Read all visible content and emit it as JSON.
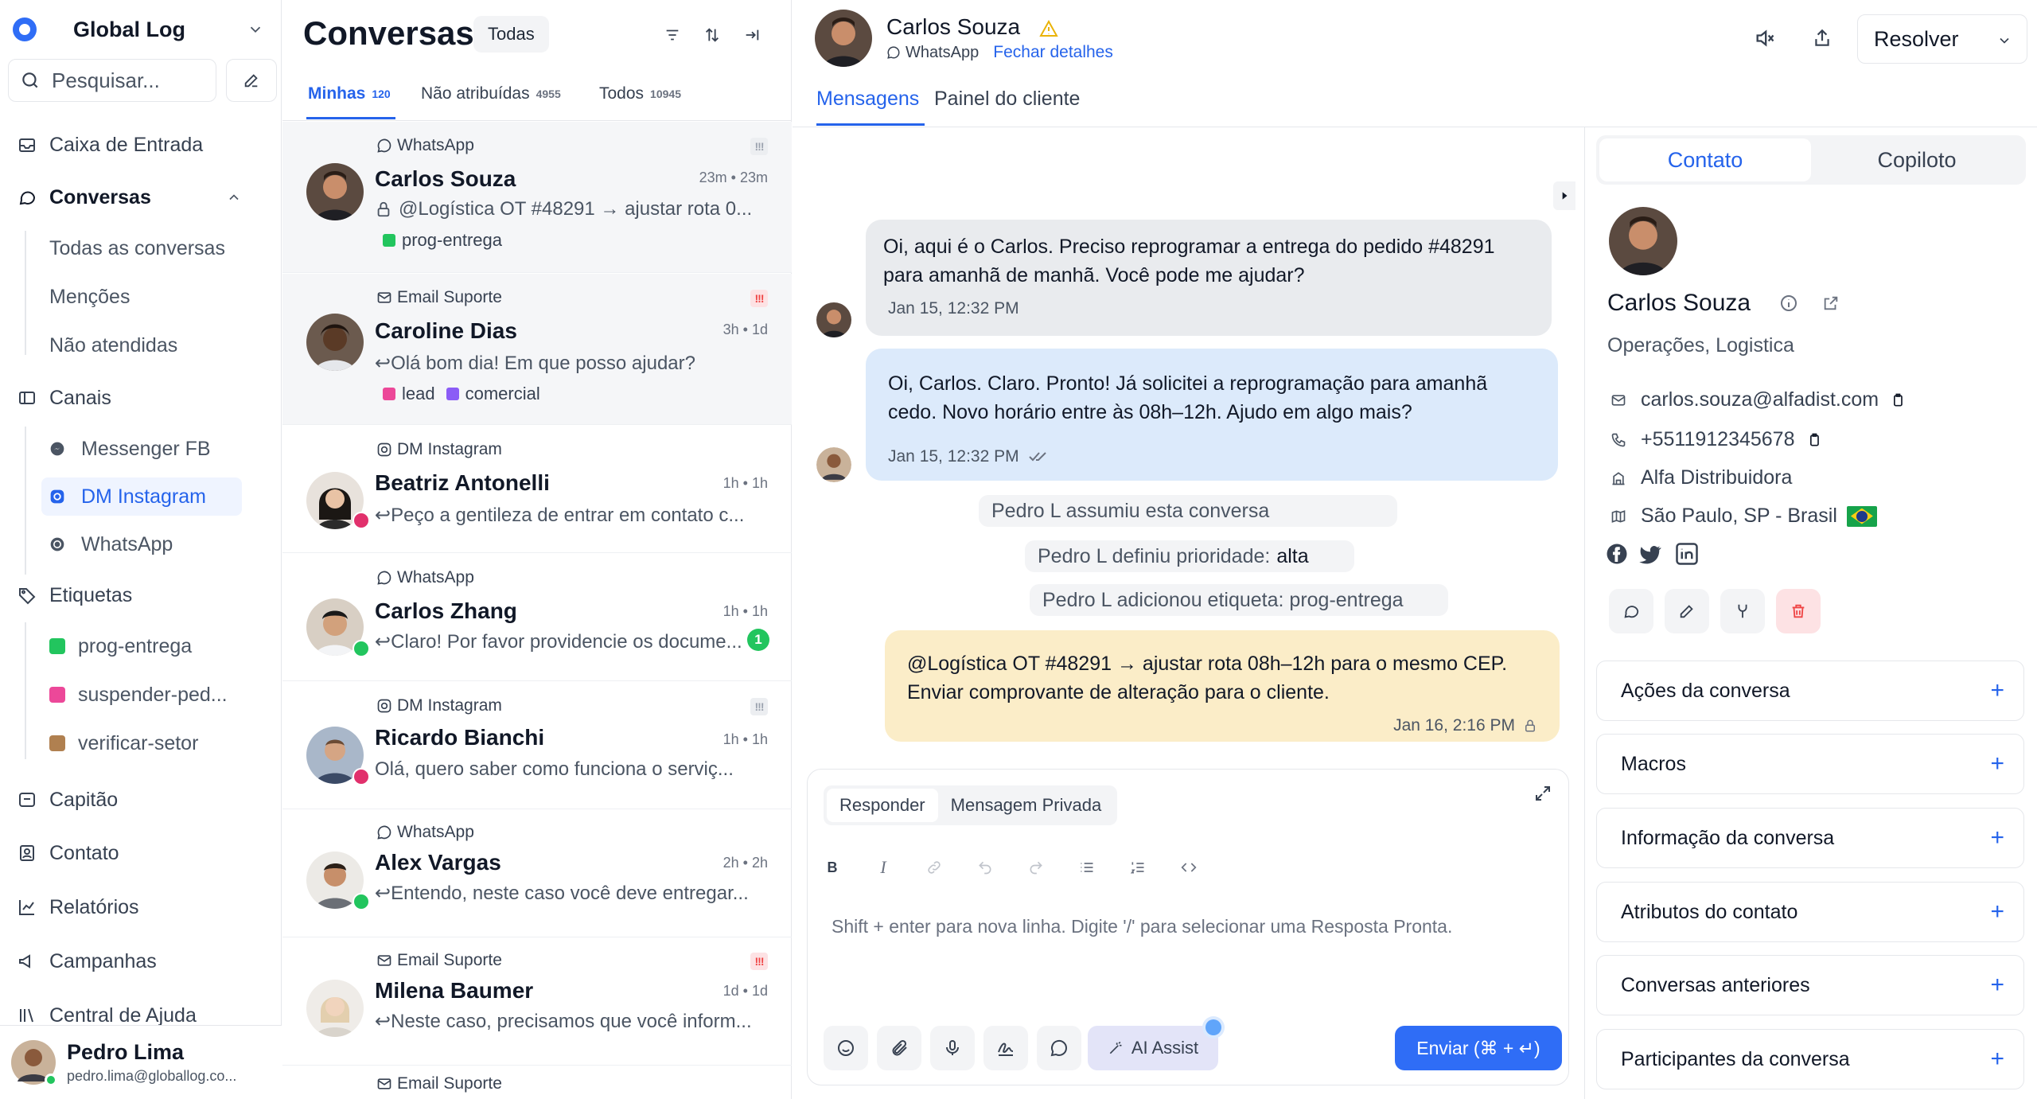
{
  "sidebar": {
    "workspace": "Global Log",
    "search_placeholder": "Pesquisar...",
    "inbox": "Caixa de Entrada",
    "conversations": "Conversas",
    "conv_subitems": [
      "Todas as conversas",
      "Menções",
      "Não atendidas"
    ],
    "channels": "Canais",
    "channel_items": [
      "Messenger FB",
      "DM Instagram",
      "WhatsApp"
    ],
    "labels_title": "Etiquetas",
    "label_items": [
      {
        "name": "prog-entrega",
        "color": "#22c55e"
      },
      {
        "name": "suspender-ped...",
        "color": "#ec4899"
      },
      {
        "name": "verificar-setor",
        "color": "#b08050"
      }
    ],
    "captain": "Capitão",
    "contact": "Contato",
    "reports": "Relatórios",
    "campaigns": "Campanhas",
    "help": "Central de Ajuda",
    "user": {
      "name": "Pedro Lima",
      "email": "pedro.lima@globallog.co..."
    }
  },
  "list": {
    "title": "Conversas",
    "filter_pill": "Todas",
    "tabs": [
      {
        "label": "Minhas",
        "count": "120"
      },
      {
        "label": "Não atribuídas",
        "count": "4955"
      },
      {
        "label": "Todos",
        "count": "10945"
      }
    ],
    "items": [
      {
        "channel": "WhatsApp",
        "name": "Carlos Souza",
        "time": "23m • 23m",
        "preview": "@Logística OT #48291 → ajustar rota 0...",
        "labels": [
          {
            "name": "prog-entrega",
            "color": "#22c55e"
          }
        ]
      },
      {
        "channel": "Email Suporte",
        "name": "Caroline Dias",
        "time": "3h • 1d",
        "preview": "Olá bom dia! Em que posso ajudar?",
        "labels": [
          {
            "name": "lead",
            "color": "#ec4899"
          },
          {
            "name": "comercial",
            "color": "#8b5cf6"
          }
        ]
      },
      {
        "channel": "DM Instagram",
        "name": "Beatriz Antonelli",
        "time": "1h • 1h",
        "preview": "Peço a gentileza de entrar em contato c..."
      },
      {
        "channel": "WhatsApp",
        "name": "Carlos Zhang",
        "time": "1h • 1h",
        "preview": "Claro! Por favor providencie os docume...",
        "unread": "1"
      },
      {
        "channel": "DM Instagram",
        "name": "Ricardo Bianchi",
        "time": "1h • 1h",
        "preview": "Olá, quero saber como funciona o serviç..."
      },
      {
        "channel": "WhatsApp",
        "name": "Alex Vargas",
        "time": "2h • 2h",
        "preview": "Entendo, neste caso você deve entregar..."
      },
      {
        "channel": "Email Suporte",
        "name": "Milena Baumer",
        "time": "1d • 1d",
        "preview": "Neste caso, precisamos que você inform..."
      },
      {
        "channel": "Email Suporte"
      }
    ]
  },
  "chat": {
    "contact_name": "Carlos Souza",
    "channel": "WhatsApp",
    "close_details": "Fechar detalhes",
    "tabs": [
      "Mensagens",
      "Painel do cliente"
    ],
    "resolve": "Resolver",
    "messages": [
      {
        "text": "Oi, aqui é o Carlos. Preciso reprogramar a entrega do pedido #48291 para amanhã de manhã. Você pode me ajudar?",
        "time": "Jan 15, 12:32 PM"
      },
      {
        "text": "Oi, Carlos. Claro. Pronto! Já solicitei a reprogramação para amanhã cedo. Novo horário entre às 08h–12h. Ajudo em algo mais?",
        "time": "Jan 15, 12:32 PM"
      },
      {
        "text": "@Logística OT #48291 → ajustar rota 08h–12h para o mesmo CEP. Enviar comprovante de alteração para o cliente.",
        "time": "Jan 16, 2:16 PM"
      }
    ],
    "activities": [
      {
        "text": "Pedro L assumiu esta conversa"
      },
      {
        "text": "Pedro L definiu prioridade:",
        "value": "alta"
      },
      {
        "text": "Pedro L adicionou etiqueta: prog-entrega"
      }
    ],
    "editor": {
      "tabs": [
        "Responder",
        "Mensagem Privada"
      ],
      "placeholder": "Shift + enter para nova linha. Digite '/' para selecionar uma Resposta Pronta.",
      "ai_assist": "AI Assist",
      "send": "Enviar (⌘ + ↵)"
    }
  },
  "contact_panel": {
    "tabs": [
      "Contato",
      "Copiloto"
    ],
    "name": "Carlos Souza",
    "role": "Operações, Logistica",
    "email": "carlos.souza@alfadist.com",
    "phone": "+5511912345678",
    "company": "Alfa Distribuidora",
    "location": "São Paulo, SP - Brasil",
    "sections": [
      "Ações da conversa",
      "Macros",
      "Informação da conversa",
      "Atributos do contato",
      "Conversas anteriores",
      "Participantes da conversa"
    ]
  }
}
